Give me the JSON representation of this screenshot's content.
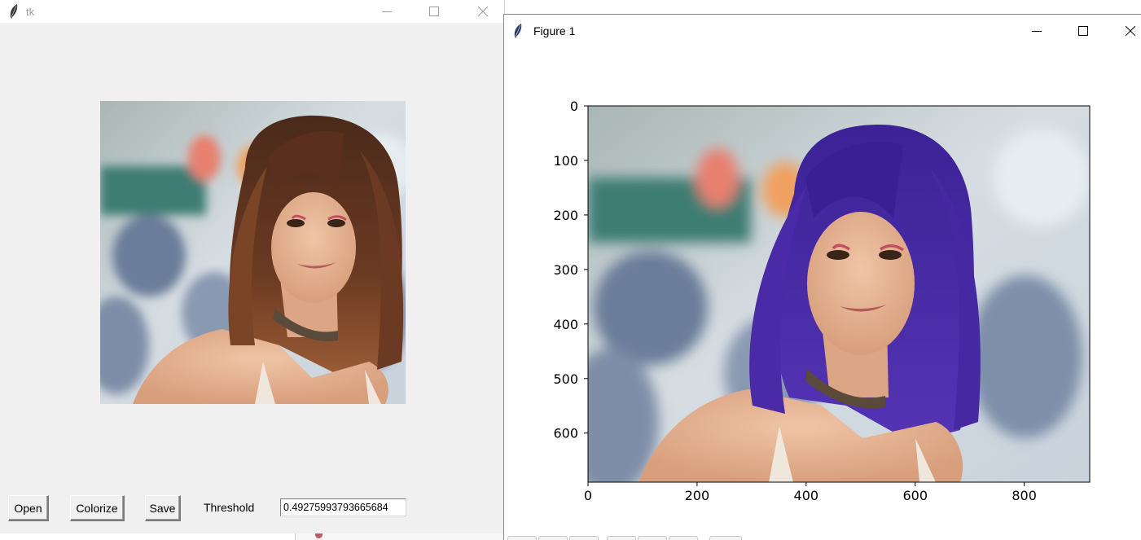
{
  "tk_window": {
    "title": "tk",
    "buttons": {
      "open": "Open",
      "colorize": "Colorize",
      "save": "Save"
    },
    "threshold_label": "Threshold",
    "threshold_value": "0.49275993793665684"
  },
  "figure_window": {
    "title": "Figure 1"
  },
  "chart_data": {
    "type": "image",
    "title": "",
    "xlabel": "",
    "ylabel": "",
    "xlim": [
      0,
      920
    ],
    "ylim": [
      690,
      0
    ],
    "x_ticks": [
      0,
      200,
      400,
      600,
      800
    ],
    "y_ticks": [
      0,
      100,
      200,
      300,
      400,
      500,
      600
    ],
    "x_tick_labels": [
      "0",
      "200",
      "400",
      "600",
      "800"
    ],
    "y_tick_labels": [
      "0",
      "100",
      "200",
      "300",
      "400",
      "500",
      "600"
    ]
  },
  "colors": {
    "recolored_hair": "#4a2aa6",
    "original_hair": "#6b3a22",
    "skin": "#e8b898",
    "window_bg": "#f0f0f0"
  },
  "icons": [
    "feather-icon",
    "minimize-icon",
    "maximize-icon",
    "close-icon"
  ]
}
